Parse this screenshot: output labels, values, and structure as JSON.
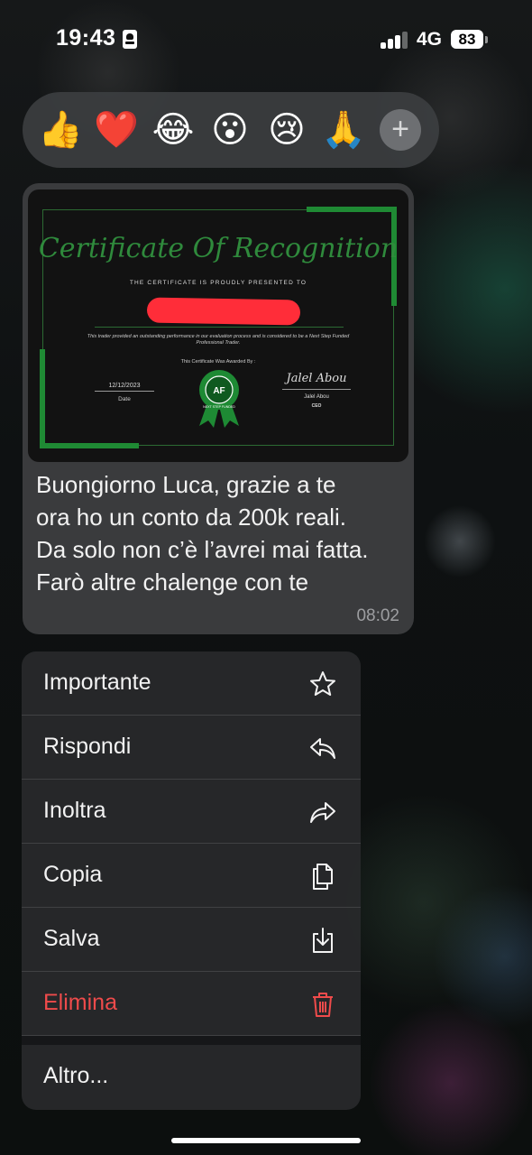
{
  "status_bar": {
    "time": "19:43",
    "network": "4G",
    "battery": "83"
  },
  "reactions": {
    "emojis": [
      "👍",
      "❤️",
      "😂",
      "😮",
      "😢",
      "🙏"
    ],
    "more_label": "+"
  },
  "message": {
    "text": "Buongiorno Luca, grazie a te\nora ho un conto da 200k reali.\nDa solo non c’è l’avrei mai fatta.\nFarò altre chalenge con te",
    "time": "08:02",
    "certificate": {
      "title": "Certificate Of Recognition",
      "subtitle": "THE CERTIFICATE IS PROUDLY PRESENTED TO",
      "description": "This trader provided an outstanding performance in our evaluation process and is considered to be a Next Step Funded Professional Trader.",
      "awarded_by": "This Certificate Was Awarded By :",
      "date": "12/12/2023",
      "date_label": "Date",
      "badge_text": "NEXT STEP FUNDED",
      "signature": "Jalel Abou",
      "signer": "Jalel Abou",
      "role": "CEO"
    }
  },
  "context_menu": {
    "items": [
      {
        "label": "Importante",
        "icon": "star-icon"
      },
      {
        "label": "Rispondi",
        "icon": "reply-icon"
      },
      {
        "label": "Inoltra",
        "icon": "forward-icon"
      },
      {
        "label": "Copia",
        "icon": "copy-icon"
      },
      {
        "label": "Salva",
        "icon": "save-icon"
      },
      {
        "label": "Elimina",
        "icon": "trash-icon"
      },
      {
        "label": "Altro...",
        "icon": ""
      }
    ],
    "danger_color": "#ef4b4b"
  }
}
